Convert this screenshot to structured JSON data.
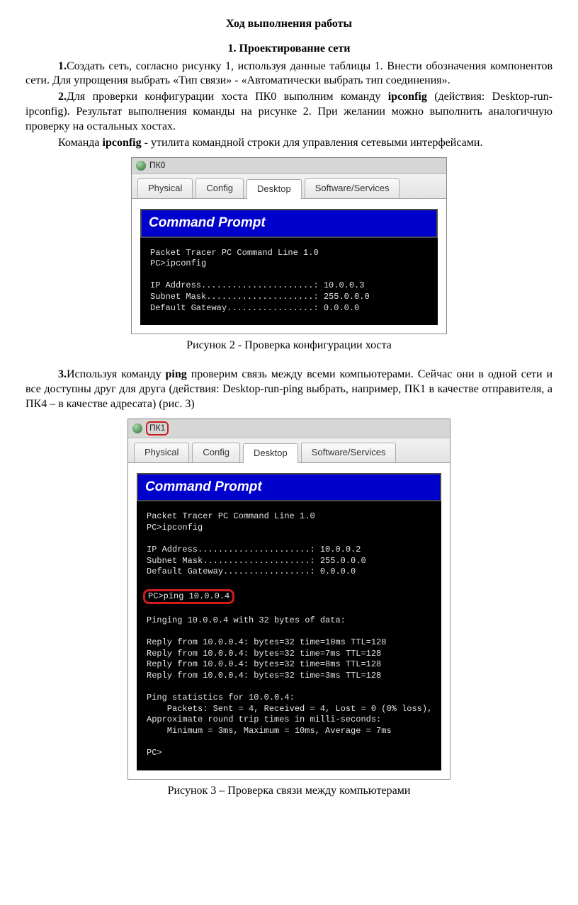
{
  "title": "Ход выполнения работы",
  "section": "1. Проектирование сети",
  "p1_num": "1.",
  "p1": "Создать сеть, согласно рисунку 1, используя данные таблицы 1. Внести обозначения компонентов сети. Для упрощения выбрать «Тип связи» - «Автоматически выбрать тип соединения».",
  "p2_num": "2.",
  "p2a": "Для проверки конфигурации хоста ПК0 выполним команду ",
  "p2_cmd": "ipconfig",
  "p2b": " (действия: Desktop-run- ipconfig). Результат выполнения команды на рисунке 2. При желании можно выполнить аналогичную проверку на остальных хостах.",
  "p3a": "Команда ",
  "p3_cmd": "ipconfig",
  "p3b": " - утилита командной строки для управления сетевыми интерфейсами.",
  "fig1": {
    "title": "ПК0",
    "tabs": [
      "Physical",
      "Config",
      "Desktop",
      "Software/Services"
    ],
    "activeTab": "Desktop",
    "promptTitle": "Command Prompt",
    "term": "Packet Tracer PC Command Line 1.0\nPC>ipconfig\n\nIP Address......................: 10.0.0.3\nSubnet Mask.....................: 255.0.0.0\nDefault Gateway.................: 0.0.0.0"
  },
  "caption1": "Рисунок 2 - Проверка конфигурации хоста",
  "p4_num": "3.",
  "p4a": "Используя команду ",
  "p4_cmd": "ping",
  "p4b": " проверим связь между всеми компьютерами. Сейчас они в одной сети и все доступны друг для друга (действия: Desktop-run-ping выбрать, например, ПК1 в качестве отправителя, а ПК4 – в качестве адресата) (рис. 3)",
  "fig2": {
    "title": "ПК1",
    "tabs": [
      "Physical",
      "Config",
      "Desktop",
      "Software/Services"
    ],
    "activeTab": "Desktop",
    "promptTitle": "Command Prompt",
    "term_pre": "Packet Tracer PC Command Line 1.0\nPC>ipconfig\n\nIP Address......................: 10.0.0.2\nSubnet Mask.....................: 255.0.0.0\nDefault Gateway.................: 0.0.0.0\n\n",
    "term_hl": "PC>ping 10.0.0.4",
    "term_post": "\n\nPinging 10.0.0.4 with 32 bytes of data:\n\nReply from 10.0.0.4: bytes=32 time=10ms TTL=128\nReply from 10.0.0.4: bytes=32 time=7ms TTL=128\nReply from 10.0.0.4: bytes=32 time=8ms TTL=128\nReply from 10.0.0.4: bytes=32 time=3ms TTL=128\n\nPing statistics for 10.0.0.4:\n    Packets: Sent = 4, Received = 4, Lost = 0 (0% loss),\nApproximate round trip times in milli-seconds:\n    Minimum = 3ms, Maximum = 10ms, Average = 7ms\n\nPC>"
  },
  "caption2": "Рисунок 3 – Проверка связи между компьютерами"
}
